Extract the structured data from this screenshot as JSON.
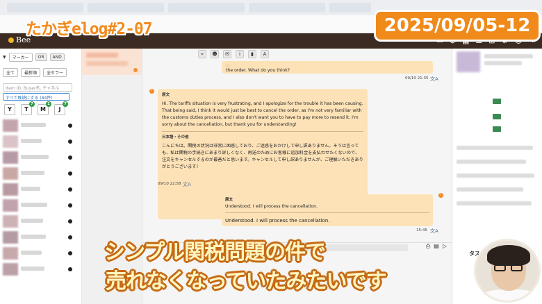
{
  "overlay": {
    "vlog_title": "たかぎelog#2-07",
    "date": "2025/09/05-12",
    "subtitle_line1": "シンプル関税問題の件で",
    "subtitle_line2": "売れなくなっていたみたいです"
  },
  "app": {
    "name": "Bee"
  },
  "sidebar": {
    "filter_label": "マーカー",
    "toggle_or": "OR",
    "toggle_and": "AND",
    "select_all": "全て",
    "select_newest": "最新順",
    "select_all_sellers": "全セラー",
    "search_placeholder": "Item ID, Buyer名, チャネル",
    "mark_all_read": "すべて既読にする (84件)",
    "markets": [
      {
        "letter": "Y",
        "badge": ""
      },
      {
        "letter": "T",
        "badge": "7"
      },
      {
        "letter": "M",
        "badge": "1"
      },
      {
        "letter": "J",
        "badge": "7"
      }
    ]
  },
  "chat": {
    "top_message_line1": "...",
    "top_message_line2": "the order. What do you think?",
    "top_timestamp": "09/10 21:35",
    "main_label_original": "原文",
    "main_text_en": "Hi. The tariffs situation is very frustrating, and I apologize for the trouble it has been causing. That being said, I think it would just be best to cancel the order, as I'm not very familiar with the customs duties process, and I also don't want you to have to pay more to resend it. I'm sorry about the cancellation, but thank you for understanding!",
    "main_label_translation": "日本語・その他",
    "main_text_ja": "こんにちは。関税の状況は非常に困惑しており、ご迷惑をおかけして申し訳ありません。そうは言っても、私は関税の手続きにあまり詳しくなく、再送のためにお客様に追加料金を支払わせたくないので、注文をキャンセルするのが最善だと思います。キャンセルして申し訳ありませんが、ご理解いただきありがとうございます！",
    "main_timestamp": "09/10 22:58",
    "reply_label": "原文",
    "reply_text_1": "Understood. I will process the cancellation.",
    "reply_text_2": "Understood. I will process the cancellation.",
    "reply_timestamp": "15:45",
    "translate_glyph": "文A"
  },
  "right_panel": {
    "tab_label": "タス"
  },
  "colors": {
    "header_bg": "#3b2b22",
    "bubble_bg": "#fde2b8",
    "accent_orange": "#f08a1a",
    "badge_green": "#2e9d45"
  }
}
